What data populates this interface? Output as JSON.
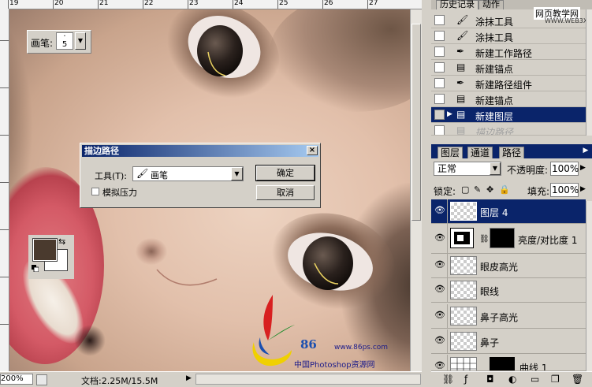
{
  "ruler": {
    "top_ticks": [
      "19",
      "20",
      "21",
      "22",
      "23",
      "24",
      "25",
      "26",
      "27"
    ]
  },
  "brush_options": {
    "label": "画笔:",
    "size": "5"
  },
  "dialog": {
    "title": "描边路径",
    "close": "×",
    "tool_label": "工具(T):",
    "tool_value": "画笔",
    "simulate_pressure": "模拟压力",
    "ok": "确定",
    "cancel": "取消"
  },
  "colors": {
    "foreground": "#4a3a2e",
    "background": "#ffffff",
    "accent": "#0a246a"
  },
  "watermark": {
    "num": "86",
    "url": "www.86ps.com",
    "cn": "中国Photoshop资源网"
  },
  "status": {
    "zoom": "200%",
    "doc": "文档:2.25M/15.5M"
  },
  "history_panel": {
    "tabs": [
      "历史记录",
      "动作"
    ],
    "site_label": "网页教学网",
    "site_url": "WWW.WEB3X.COM",
    "items": [
      {
        "icon": "brush-icon",
        "label": "涂抹工具"
      },
      {
        "icon": "brush-icon",
        "label": "涂抹工具"
      },
      {
        "icon": "pen-icon",
        "label": "新建工作路径"
      },
      {
        "icon": "doc-icon",
        "label": "新建锚点"
      },
      {
        "icon": "pen-icon",
        "label": "新建路径组件"
      },
      {
        "icon": "doc-icon",
        "label": "新建锚点"
      },
      {
        "icon": "doc-icon",
        "label": "新建图层"
      },
      {
        "icon": "doc-icon",
        "label": "描边路径"
      }
    ]
  },
  "layers_panel": {
    "tabs": [
      "图层",
      "通道",
      "路径"
    ],
    "blend_mode": "正常",
    "opacity_label": "不透明度:",
    "opacity": "100%",
    "lock_label": "锁定:",
    "fill_label": "填充:",
    "fill": "100%",
    "layers": [
      {
        "name": "图层 4"
      },
      {
        "name": "亮度/对比度 1"
      },
      {
        "name": "眼皮高光"
      },
      {
        "name": "眼线"
      },
      {
        "name": "鼻子高光"
      },
      {
        "name": "鼻子"
      },
      {
        "name": "曲线 1"
      }
    ]
  }
}
